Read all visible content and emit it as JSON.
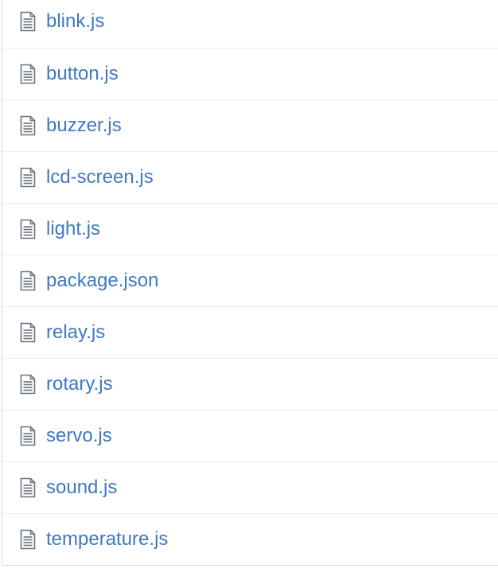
{
  "file_list": {
    "icon": "file-text-icon",
    "link_color": "#4078c0",
    "files": [
      {
        "name": "blink.js"
      },
      {
        "name": "button.js"
      },
      {
        "name": "buzzer.js"
      },
      {
        "name": "lcd-screen.js"
      },
      {
        "name": "light.js"
      },
      {
        "name": "package.json"
      },
      {
        "name": "relay.js"
      },
      {
        "name": "rotary.js"
      },
      {
        "name": "servo.js"
      },
      {
        "name": "sound.js"
      },
      {
        "name": "temperature.js"
      }
    ]
  }
}
